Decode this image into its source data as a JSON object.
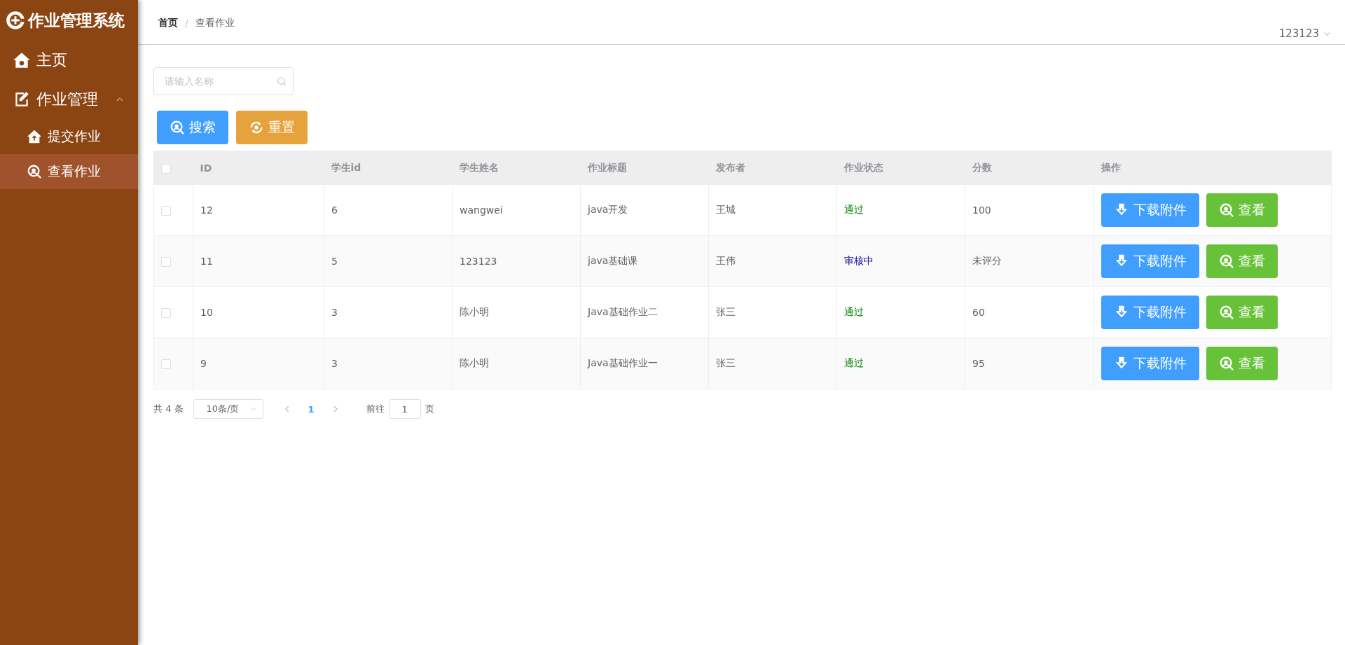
{
  "sidebar": {
    "title": "作业管理系统",
    "items": [
      {
        "label": "主页",
        "selected": false
      },
      {
        "label": "作业管理",
        "selected": false,
        "expanded": true,
        "children": [
          {
            "label": "提交作业",
            "selected": false
          },
          {
            "label": "查看作业",
            "selected": true
          }
        ]
      }
    ]
  },
  "header": {
    "breadcrumb": [
      {
        "label": "首页",
        "current": false
      },
      {
        "label": "查看作业",
        "current": true
      }
    ],
    "separator": "/",
    "user": "123123"
  },
  "search": {
    "placeholder": "请输入名称"
  },
  "buttons": [
    {
      "label": "搜索",
      "kind": "search"
    },
    {
      "label": "重置",
      "kind": "reset"
    }
  ],
  "table": {
    "select_all": {
      "checked": false
    },
    "columns": [
      "ID",
      "学生id",
      "学生姓名",
      "作业标题",
      "发布者",
      "作业状态",
      "分数",
      "操作"
    ],
    "rows": [
      {
        "checked": false,
        "cells": [
          "12",
          "6",
          "wangwei",
          "java开发",
          "王城"
        ],
        "status": {
          "text": "通过",
          "color": "#008000"
        },
        "score": "100",
        "actions": [
          "下载附件",
          "查看"
        ]
      },
      {
        "checked": false,
        "cells": [
          "11",
          "5",
          "123123",
          "java基础课",
          "王伟"
        ],
        "status": {
          "text": "审核中",
          "color": "#00008b"
        },
        "score": "未评分",
        "actions": [
          "下载附件",
          "查看"
        ]
      },
      {
        "checked": false,
        "cells": [
          "10",
          "3",
          "陈小明",
          "Java基础作业二",
          "张三"
        ],
        "status": {
          "text": "通过",
          "color": "#008000"
        },
        "score": "60",
        "actions": [
          "下载附件",
          "查看"
        ]
      },
      {
        "checked": false,
        "cells": [
          "9",
          "3",
          "陈小明",
          "Java基础作业一",
          "张三"
        ],
        "status": {
          "text": "通过",
          "color": "#008000"
        },
        "score": "95",
        "actions": [
          "下载附件",
          "查看"
        ]
      }
    ]
  },
  "pagination": {
    "total": "共 4 条",
    "page_size": "10条/页",
    "pages": [
      {
        "label": "1",
        "selected": true
      }
    ],
    "goto_label": "前往",
    "goto_value": "1",
    "goto_suffix": "页"
  }
}
